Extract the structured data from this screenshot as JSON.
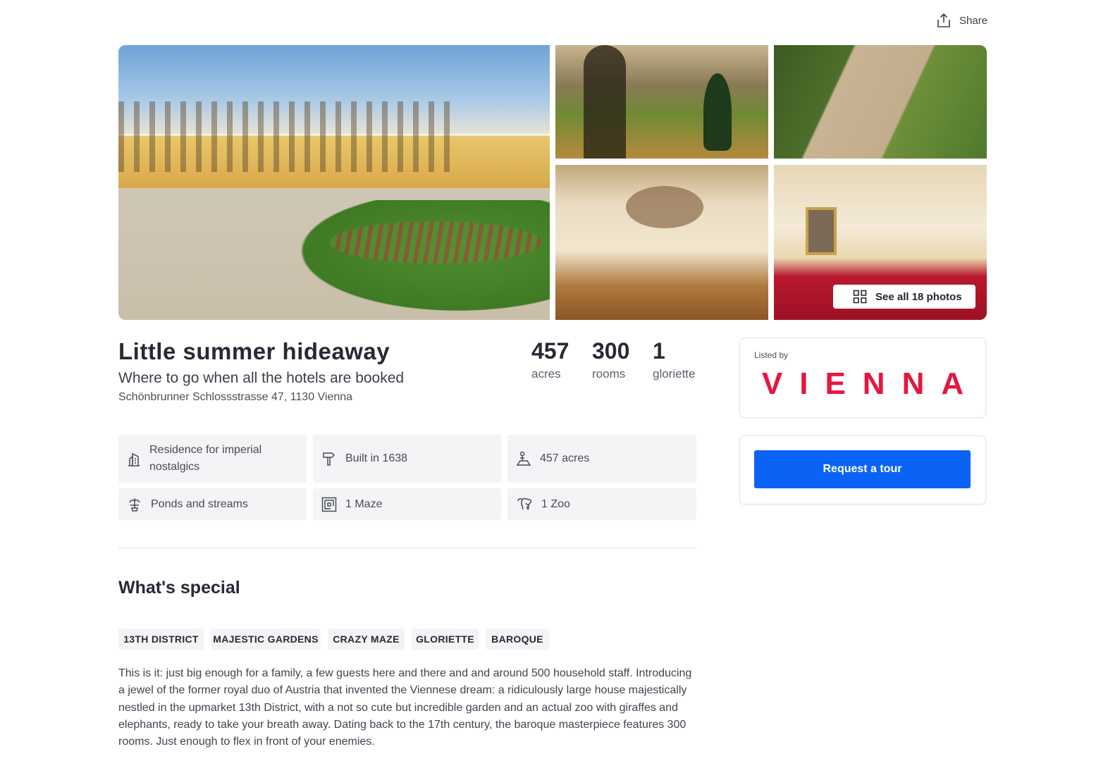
{
  "header": {
    "share_label": "Share",
    "share_icon": "share-icon"
  },
  "gallery": {
    "see_all_label": "See all 18 photos",
    "see_all_icon": "grid-icon"
  },
  "listing": {
    "title": "Little summer hideaway",
    "subtitle": "Where to go when all the hotels are booked",
    "address": "Schönbrunner Schlossstrasse 47, 1130 Vienna"
  },
  "stats": [
    {
      "value": "457",
      "label": "acres"
    },
    {
      "value": "300",
      "label": "rooms"
    },
    {
      "value": "1",
      "label": "gloriette"
    }
  ],
  "features": [
    {
      "icon": "building-icon",
      "text": "Residence for imperial nostalgics"
    },
    {
      "icon": "hammer-icon",
      "text": "Built in 1638"
    },
    {
      "icon": "land-icon",
      "text": "457 acres"
    },
    {
      "icon": "fountain-icon",
      "text": "Ponds and streams"
    },
    {
      "icon": "maze-icon",
      "text": "1 Maze"
    },
    {
      "icon": "elephant-icon",
      "text": "1 Zoo"
    }
  ],
  "special": {
    "title": "What's special",
    "tags": [
      "13TH DISTRICT",
      "MAJESTIC GARDENS",
      "CRAZY MAZE",
      "GLORIETTE",
      "BAROQUE"
    ],
    "description": "This is it: just big enough for a family, a few guests here and there and and around 500 household staff. Introducing a jewel of the former royal duo of Austria that invented the Viennese dream: a ridiculously large house majestically nestled in the upmarket 13th District, with a not so cute but incredible garden and an actual zoo with giraffes and elephants, ready to take your breath away. Dating back to the 17th century, the baroque masterpiece features 300 rooms. Just enough to flex in front of your enemies."
  },
  "sidebar": {
    "listed_by_label": "Listed by",
    "agency_name": "VIENNA",
    "request_tour_label": "Request a tour"
  },
  "colors": {
    "brand_red": "#e5173f",
    "primary_button": "#0b63f6"
  }
}
